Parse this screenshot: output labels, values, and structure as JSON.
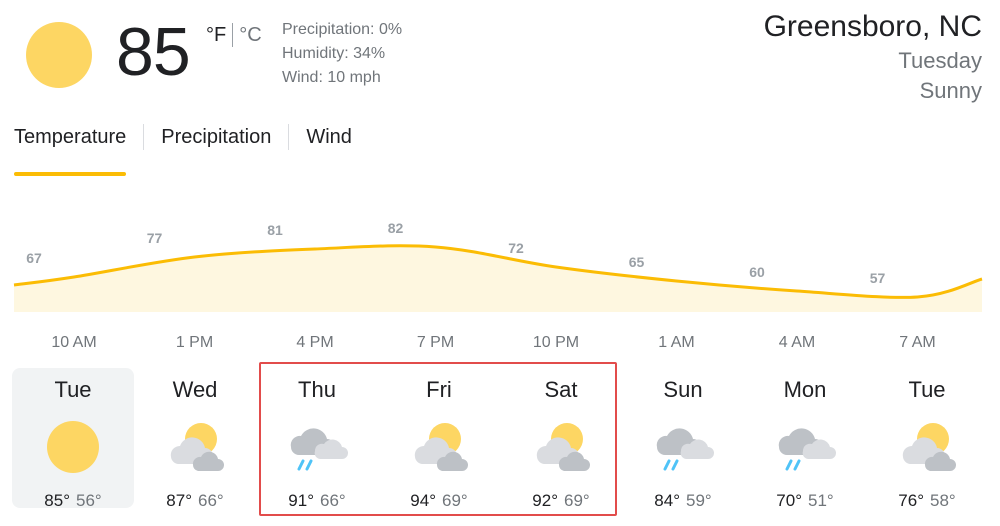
{
  "current": {
    "temperature": "85",
    "unit_f": "°F",
    "unit_c": "°C",
    "precipitation": "Precipitation: 0%",
    "humidity": "Humidity: 34%",
    "wind": "Wind: 10 mph",
    "icon": "sun-icon"
  },
  "location": {
    "city": "Greensboro, NC",
    "day": "Tuesday",
    "condition": "Sunny"
  },
  "tabs": [
    {
      "label": "Temperature",
      "active": true
    },
    {
      "label": "Precipitation",
      "active": false
    },
    {
      "label": "Wind",
      "active": false
    }
  ],
  "colors": {
    "accent": "#fbbc04",
    "area_fill": "#fef7e0",
    "highlight_box": "#e24c4b"
  },
  "chart_data": {
    "type": "area",
    "title": "",
    "xlabel": "",
    "ylabel": "",
    "x_tick_labels": [
      "10 AM",
      "1 PM",
      "4 PM",
      "7 PM",
      "10 PM",
      "1 AM",
      "4 AM",
      "7 AM"
    ],
    "data_labels": [
      67,
      77,
      81,
      82,
      72,
      65,
      60,
      57
    ],
    "grid": false,
    "legend": "none"
  },
  "forecast": [
    {
      "day": "Tue",
      "icon": "sun-icon",
      "high": "85°",
      "low": "56°",
      "selected": true
    },
    {
      "day": "Wed",
      "icon": "partly-cloudy-icon",
      "high": "87°",
      "low": "66°",
      "selected": false
    },
    {
      "day": "Thu",
      "icon": "rain-icon",
      "high": "91°",
      "low": "66°",
      "selected": false
    },
    {
      "day": "Fri",
      "icon": "partly-cloudy-icon",
      "high": "94°",
      "low": "69°",
      "selected": false
    },
    {
      "day": "Sat",
      "icon": "partly-cloudy-icon",
      "high": "92°",
      "low": "69°",
      "selected": false
    },
    {
      "day": "Sun",
      "icon": "rain-icon",
      "high": "84°",
      "low": "59°",
      "selected": false
    },
    {
      "day": "Mon",
      "icon": "rain-icon",
      "high": "70°",
      "low": "51°",
      "selected": false
    },
    {
      "day": "Tue",
      "icon": "partly-cloudy-icon",
      "high": "76°",
      "low": "58°",
      "selected": false
    }
  ]
}
